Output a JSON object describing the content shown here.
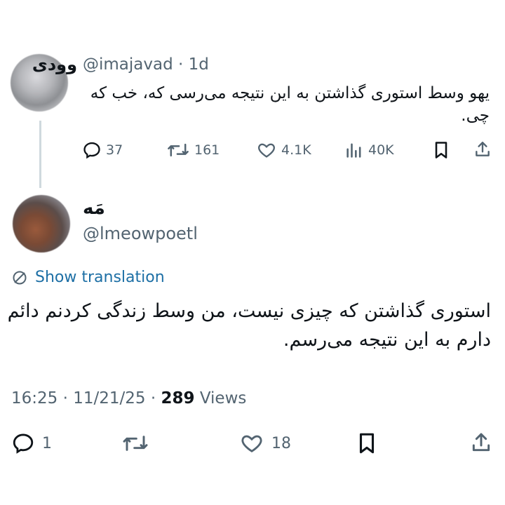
{
  "reply_parent": {
    "display_name": "وودی",
    "handle": "@imajavad",
    "separator": "·",
    "age": "1d",
    "text": "یهو وسط استوری گذاشتن به این نتیجه می‌رسی که، خب که چی.",
    "stats": {
      "replies": "37",
      "reposts": "161",
      "likes": "4.1K",
      "views": "40K"
    }
  },
  "main_tweet": {
    "display_name": "مَه",
    "handle": "@lmeowpoetl",
    "translate_label": "Show translation",
    "text": "استوری گذاشتن که چیزی نیست، من وسط زندگی کردنم دائم دارم به این نتیجه می‌رسم.",
    "time": "16:25",
    "date": "11/21/25",
    "views_count": "289",
    "views_label": "Views",
    "dot": "·",
    "stats": {
      "replies": "1",
      "likes": "18"
    }
  },
  "icons": [
    "reply-icon",
    "repost-icon",
    "like-icon",
    "views-icon",
    "bookmark-icon",
    "share-icon",
    "translate-globe-icon"
  ],
  "colors": {
    "text": "#0f1419",
    "muted": "#536471",
    "link": "#1d6fa5",
    "thread_line": "#cfd9de"
  }
}
